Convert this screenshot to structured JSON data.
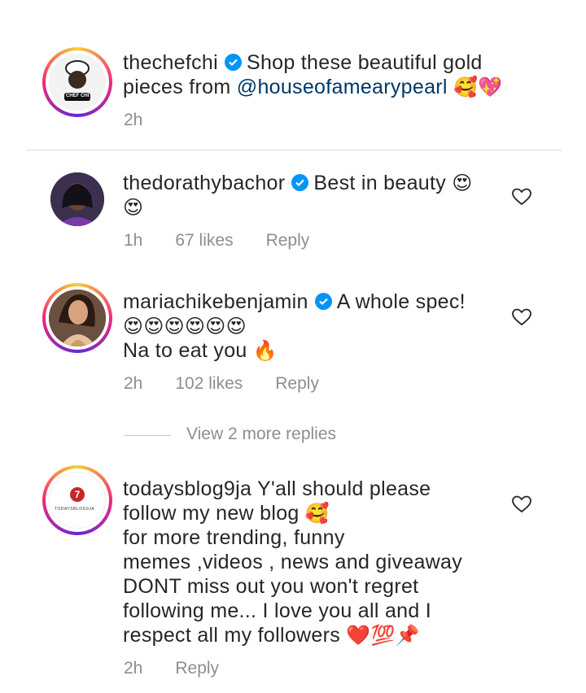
{
  "caption": {
    "username": "thechefchi",
    "text_before_mention": "Shop these beautiful gold pieces from ",
    "mention": "@houseofamearypearl",
    "emojis": "🥰💖",
    "time": "2h",
    "avatar_logo_text": "CHEF CHI"
  },
  "comments": [
    {
      "username": "thedorathybachor",
      "text": "Best in beauty",
      "emojis_line1": "😍",
      "emojis_line2": "😍",
      "time": "1h",
      "likes": "67 likes",
      "reply": "Reply"
    },
    {
      "username": "mariachikebenjamin",
      "text": "A whole spec!",
      "emojis_line2": "😍😍😍😍😍😍",
      "line3": "Na to eat you",
      "line3_emoji": "🔥",
      "time": "2h",
      "likes": "102 likes",
      "reply": "Reply",
      "view_more": "View 2 more replies"
    },
    {
      "username": "todaysblog9ja",
      "line1": "Y'all should please",
      "line2": "follow my new blog",
      "line2_emoji": "🥰",
      "line3": "for more trending, funny",
      "line4": "memes ,videos , news and giveaway",
      "line5": "DONT miss out you won't regret",
      "line6": "following me... I love you all and I",
      "line7": "respect all my followers",
      "line7_emojis": "❤️💯📌",
      "time": "2h",
      "reply": "Reply",
      "avatar_logo_text": "TODAYSBLOG9JA"
    }
  ],
  "colors": {
    "verified": "#0095f6",
    "mention": "#00376b",
    "muted": "#8e8e8e",
    "text": "#262626"
  }
}
